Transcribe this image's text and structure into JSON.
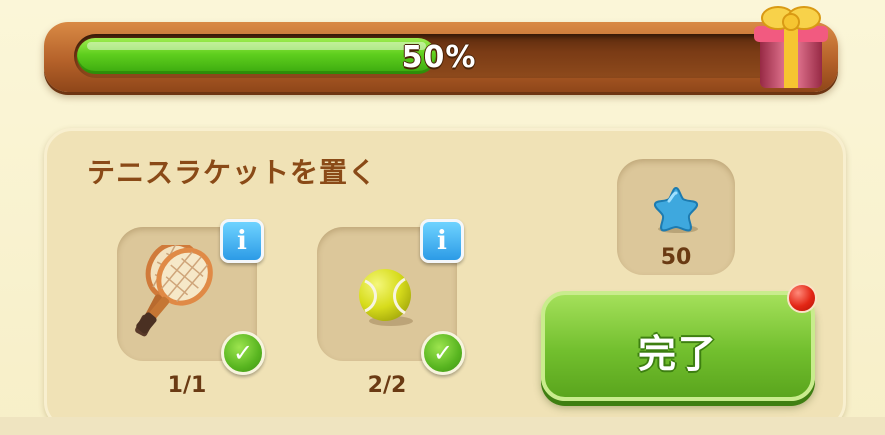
{
  "progress": {
    "fraction": 0.5,
    "label": "50%",
    "reward_icon": "gift-box-icon"
  },
  "task": {
    "title": "テニスラケットを置く",
    "items": [
      {
        "icon": "tennis-rackets-icon",
        "count": "1/1",
        "completed": true
      },
      {
        "icon": "tennis-ball-icon",
        "count": "2/2",
        "completed": true
      }
    ],
    "info_glyph": "i",
    "check_glyph": "✓"
  },
  "reward": {
    "icon": "blue-star-icon",
    "amount": "50"
  },
  "complete_button": {
    "label": "完了",
    "has_notification": true
  },
  "colors": {
    "progress_fill": "#5fcf1e",
    "button_green": "#72bf2e",
    "title_brown": "#8a4a17",
    "notification_red": "#e32615",
    "info_blue": "#2c9be6"
  }
}
